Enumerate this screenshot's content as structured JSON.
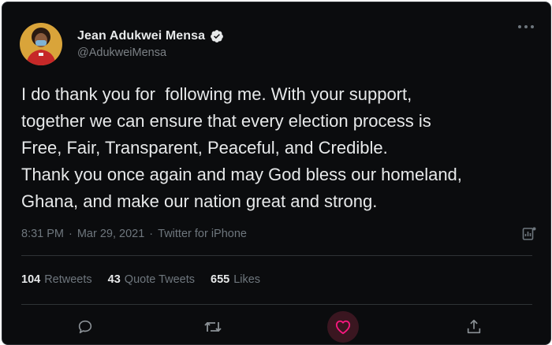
{
  "author": {
    "name": "Jean Adukwei Mensa",
    "handle": "@AdukweiMensa",
    "verified": true
  },
  "tweet": {
    "text": "I do thank you for  following me. With your support,\ntogether we can ensure that every election process is\nFree, Fair, Transparent, Peaceful, and Credible.\nThank you once again and may God bless our homeland,\nGhana, and make our nation great and strong.",
    "time": "8:31 PM",
    "date": "Mar 29, 2021",
    "source": "Twitter for iPhone",
    "separator": "·"
  },
  "stats": {
    "retweets": {
      "count": "104",
      "label": "Retweets"
    },
    "quotes": {
      "count": "43",
      "label": "Quote Tweets"
    },
    "likes": {
      "count": "655",
      "label": "Likes"
    }
  },
  "icons": {
    "more": "more-icon",
    "verified": "verified-badge-icon",
    "analytics": "analytics-icon",
    "reply": "reply-icon",
    "retweet": "retweet-icon",
    "like": "heart-icon",
    "share": "share-icon"
  },
  "colors": {
    "background": "#0b0c0e",
    "text": "#e7e9ea",
    "secondary": "#6e767d",
    "like": "#f91880"
  }
}
